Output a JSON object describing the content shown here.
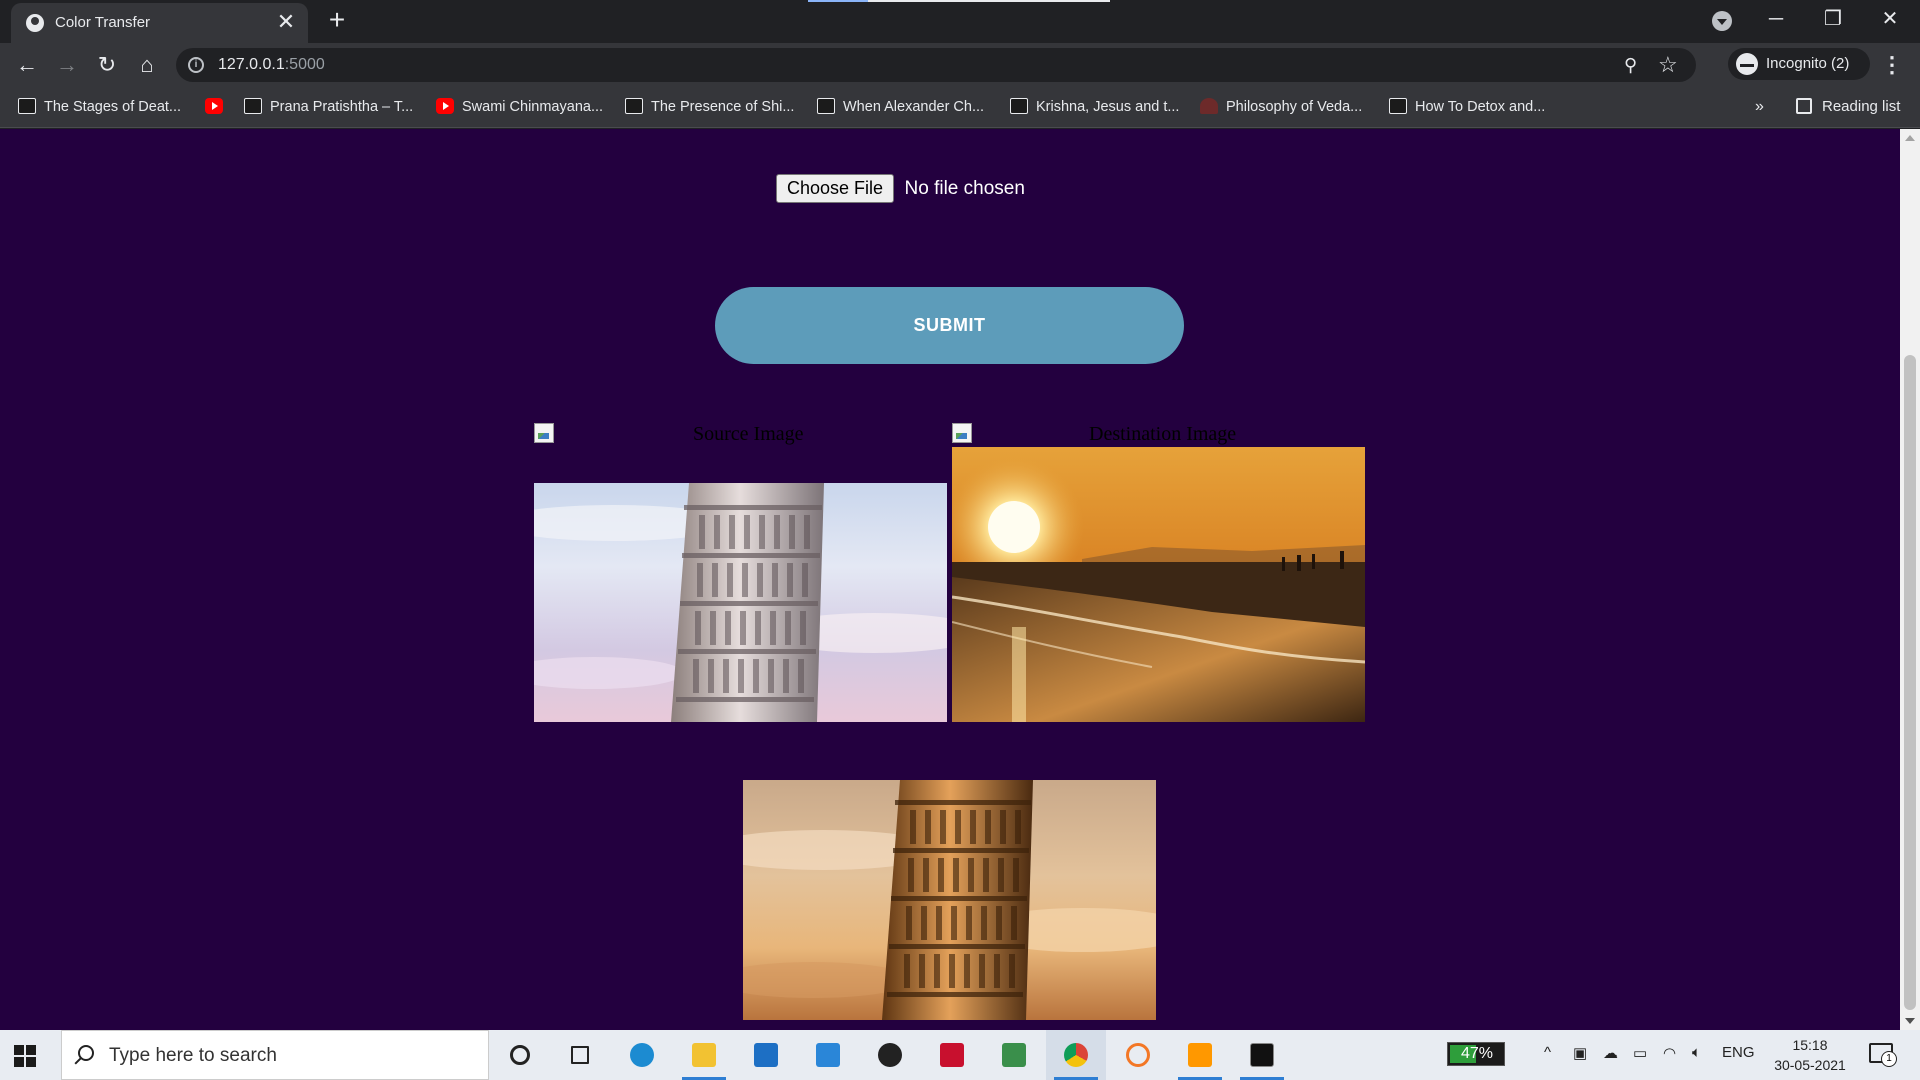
{
  "browser": {
    "tab_title": "Color Transfer",
    "close_glyph": "✕",
    "new_tab_glyph": "+",
    "url_host": "127.0.0.1",
    "url_port": ":5000",
    "profile_label": "Incognito (2)",
    "window_controls": {
      "minimize": "─",
      "restore": "❐",
      "close": "✕"
    },
    "nav": {
      "back": "←",
      "forward": "→",
      "reload": "↻",
      "home": "⌂"
    },
    "zoom_glyph": "⚲",
    "star_glyph": "☆",
    "menu_glyph": "⋮"
  },
  "bookmarks": [
    {
      "label": "The Stages of Deat...",
      "icon": "page"
    },
    {
      "label": "",
      "icon": "yt"
    },
    {
      "label": "Prana Pratishtha – T...",
      "icon": "page"
    },
    {
      "label": "Swami Chinmayana...",
      "icon": "yt"
    },
    {
      "label": "The Presence of Shi...",
      "icon": "page"
    },
    {
      "label": "When Alexander Ch...",
      "icon": "page"
    },
    {
      "label": "Krishna, Jesus and t...",
      "icon": "page"
    },
    {
      "label": "Philosophy of Veda...",
      "icon": "leaf"
    },
    {
      "label": "How To Detox and...",
      "icon": "page"
    }
  ],
  "bookmarks_more": "»",
  "reading_list_label": "Reading list",
  "page": {
    "file_button_label": "Choose File",
    "file_status": "No file chosen",
    "submit_label": "SUBMIT",
    "source_alt": "Source Image",
    "destination_alt": "Destination Image"
  },
  "taskbar": {
    "search_placeholder": "Type here to search",
    "battery_percent": "47%",
    "language": "ENG",
    "time": "15:18",
    "date": "30-05-2021",
    "notification_count": "1"
  }
}
